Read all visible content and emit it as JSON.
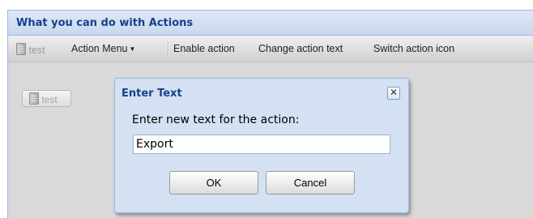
{
  "panel": {
    "title": "What you can do with Actions"
  },
  "toolbar": {
    "test_label": "test",
    "action_menu_label": "Action Menu",
    "enable_action_label": "Enable action",
    "change_action_text_label": "Change action text",
    "switch_action_icon_label": "Switch action icon"
  },
  "body": {
    "test_button_label": "test"
  },
  "dialog": {
    "title": "Enter Text",
    "prompt": "Enter new text for the action:",
    "input_value": "Export",
    "ok_label": "OK",
    "cancel_label": "Cancel",
    "close_glyph": "✕"
  },
  "colors": {
    "header_text": "#15428b",
    "border": "#99bbe8",
    "dialog_bg": "#d4e1f3"
  }
}
